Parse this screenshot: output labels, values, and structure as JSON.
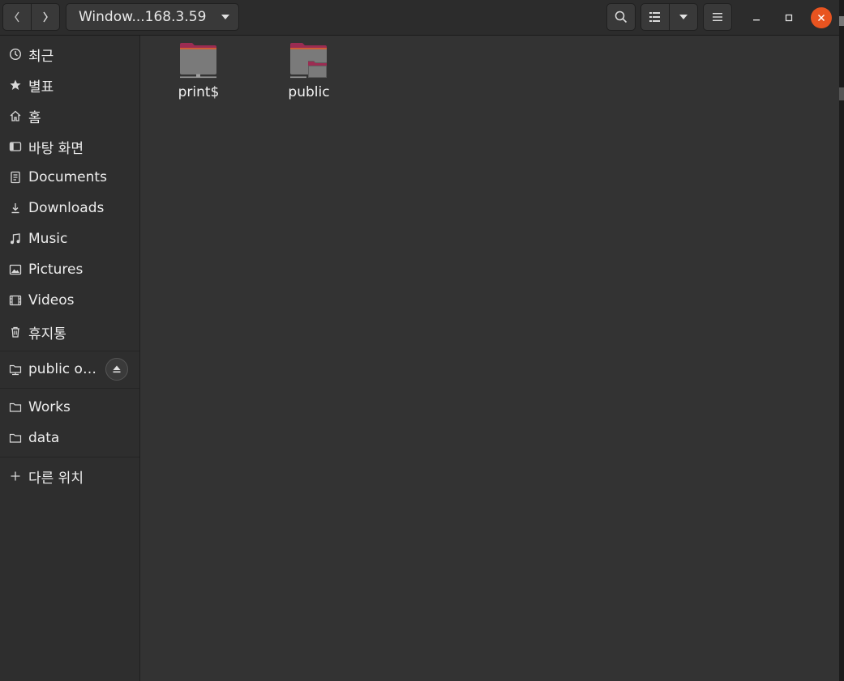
{
  "window": {
    "path_label": "Window...168.3.59"
  },
  "header": {
    "back_icon": "chevron-left-icon",
    "forward_icon": "chevron-right-icon",
    "search_icon": "search-icon",
    "view_icon": "list-view-icon",
    "menu_icon": "hamburger-menu-icon"
  },
  "sidebar": {
    "items": [
      {
        "label": "최근",
        "icon": "clock-icon"
      },
      {
        "label": "별표",
        "icon": "star-icon"
      },
      {
        "label": "홈",
        "icon": "home-icon"
      },
      {
        "label": "바탕 화면",
        "icon": "desktop-icon"
      },
      {
        "label": "Documents",
        "icon": "document-icon"
      },
      {
        "label": "Downloads",
        "icon": "download-icon"
      },
      {
        "label": "Music",
        "icon": "music-icon"
      },
      {
        "label": "Pictures",
        "icon": "picture-icon"
      },
      {
        "label": "Videos",
        "icon": "video-icon"
      },
      {
        "label": "휴지통",
        "icon": "trash-icon"
      }
    ],
    "mount": {
      "label": "public o…",
      "icon": "network-folder-icon"
    },
    "bookmarks": [
      {
        "label": "Works",
        "icon": "folder-icon"
      },
      {
        "label": "data",
        "icon": "folder-icon"
      }
    ],
    "other_locations": {
      "label": "다른 위치",
      "icon": "plus-icon"
    }
  },
  "content": {
    "items": [
      {
        "label": "print$",
        "icon": "network-printer-share-icon"
      },
      {
        "label": "public",
        "icon": "shared-folder-icon"
      }
    ]
  },
  "colors": {
    "accent": "#e95420",
    "folder_tab": "#9b2c52",
    "folder_body": "#7a7a7a"
  }
}
